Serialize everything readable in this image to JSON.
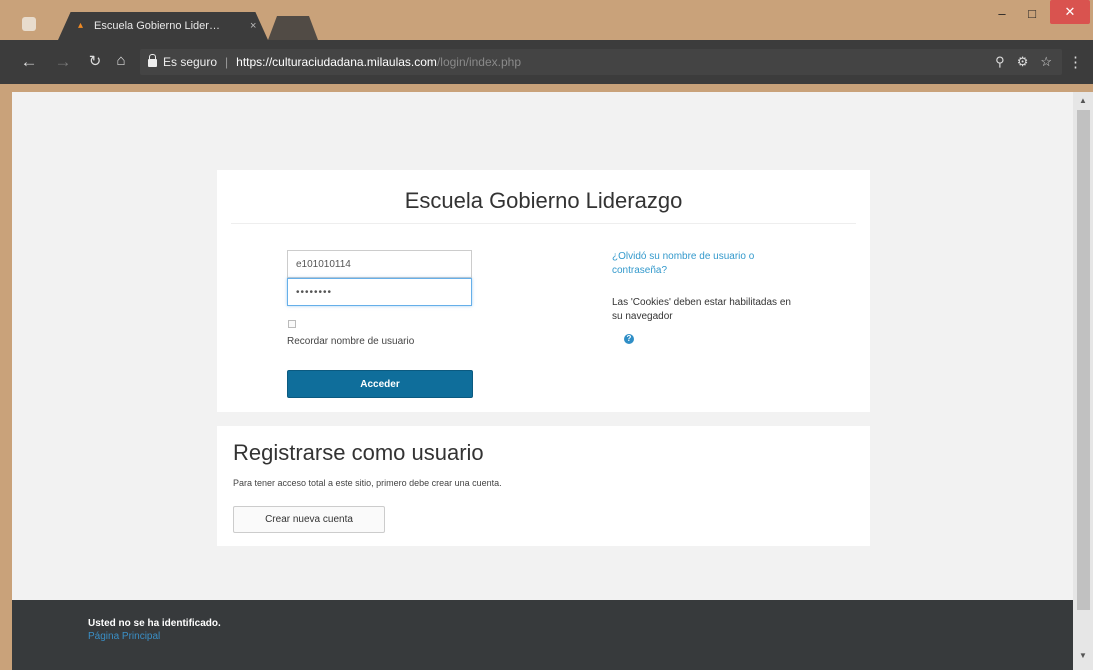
{
  "browser": {
    "tab_title": "Escuela Gobierno Lider…",
    "tab_close": "×",
    "secure_label": "Es seguro",
    "url_host": "https://culturaciudadana.milaulas.com",
    "url_path": "/login/index.php",
    "icons": [
      "back-icon",
      "forward-icon",
      "reload-icon",
      "home-icon",
      "lock-icon",
      "search-icon",
      "key-icon",
      "star-icon",
      "menu-icon"
    ]
  },
  "login": {
    "site_title": "Escuela Gobierno Liderazgo",
    "username_value": "e101010114",
    "password_value": "••••••••",
    "remember_label": "Recordar nombre de usuario",
    "remember_checked": false,
    "submit_label": "Acceder",
    "forgot_link": "¿Olvidó su nombre de usuario o contraseña?",
    "cookies_note": "Las 'Cookies' deben estar habilitadas en su navegador"
  },
  "signup": {
    "title": "Registrarse como usuario",
    "description": "Para tener acceso total a este sitio, primero debe crear una cuenta.",
    "button_label": "Crear nueva cuenta"
  },
  "footer": {
    "status": "Usted no se ha identificado.",
    "home_link": "Página Principal"
  },
  "colors": {
    "primary_button": "#0f6e9b",
    "link": "#3399cc",
    "footer_bg": "#373a3c",
    "window_frame": "#c9a27a"
  }
}
